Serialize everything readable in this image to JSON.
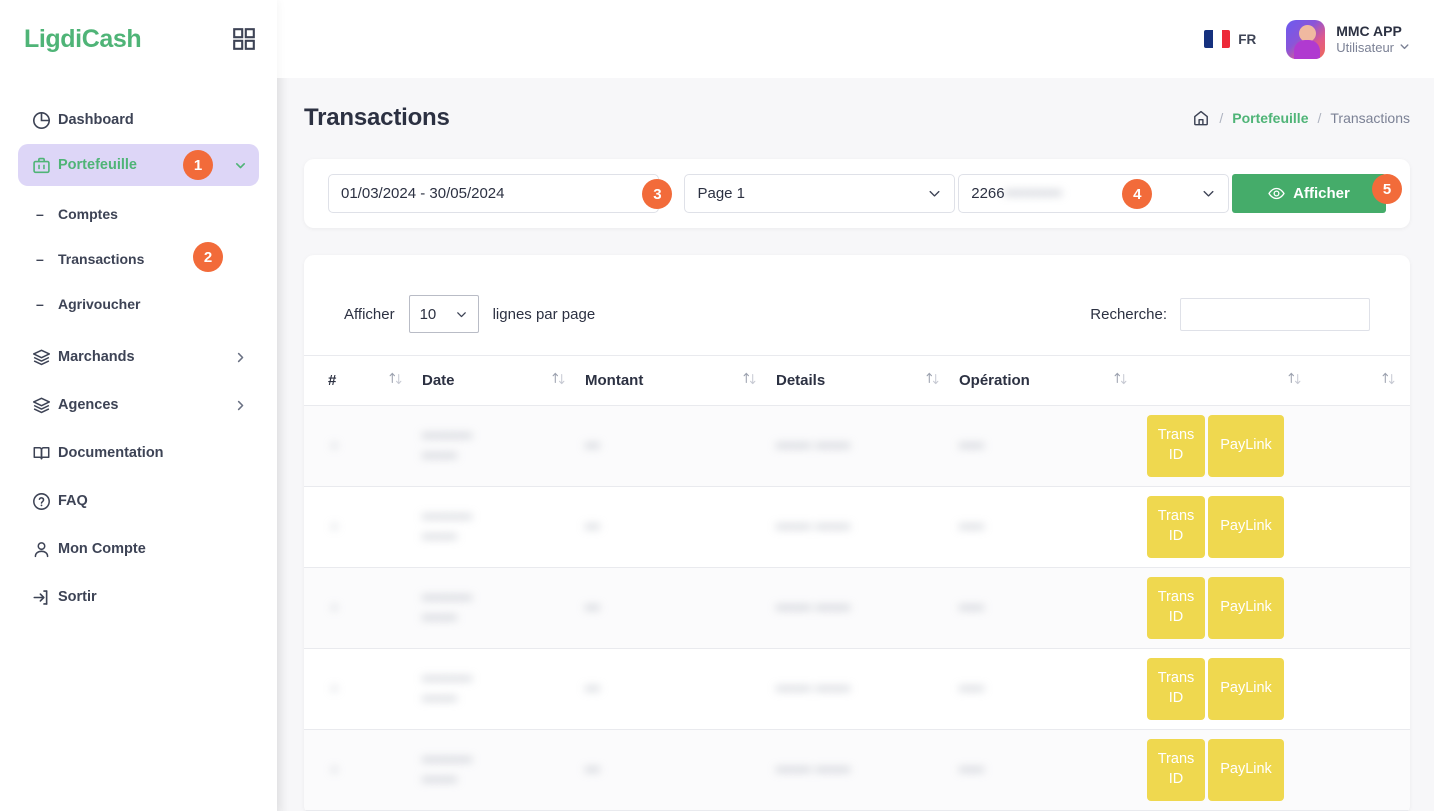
{
  "brand": {
    "name": "LigdiCash",
    "grid_icon": "grid-icon"
  },
  "header": {
    "language": {
      "code": "FR",
      "flag": "french-flag-icon"
    },
    "user": {
      "name": "MMC APP",
      "role": "Utilisateur",
      "avatar": "user-avatar"
    }
  },
  "sidebar": {
    "items": [
      {
        "label": "Dashboard",
        "icon": "pie-chart-icon"
      },
      {
        "label": "Portefeuille",
        "icon": "briefcase-icon",
        "active": true,
        "badge": "1",
        "chevron": "chevron-down-icon"
      },
      {
        "label": "Comptes",
        "icon": "dash-icon",
        "sub": true
      },
      {
        "label": "Transactions",
        "icon": "dash-icon",
        "sub": true,
        "badge": "2"
      },
      {
        "label": "Agrivoucher",
        "icon": "dash-icon",
        "sub": true
      },
      {
        "label": "Marchands",
        "icon": "layers-icon",
        "chevron": "chevron-right-icon"
      },
      {
        "label": "Agences",
        "icon": "layers-icon",
        "chevron": "chevron-right-icon"
      },
      {
        "label": "Documentation",
        "icon": "book-icon"
      },
      {
        "label": "FAQ",
        "icon": "question-circle-icon"
      },
      {
        "label": "Mon Compte",
        "icon": "user-icon"
      },
      {
        "label": "Sortir",
        "icon": "logout-icon"
      }
    ]
  },
  "page": {
    "title": "Transactions",
    "breadcrumb": {
      "home_icon": "home-icon",
      "sep": "/",
      "link": "Portefeuille",
      "current": "Transactions"
    }
  },
  "filters": {
    "date_range": "01/03/2024 - 30/05/2024",
    "date_badge": "3",
    "page_select": "Page 1",
    "account_select": "2266",
    "account_select_masked": "••••••••••",
    "account_badge": "4",
    "submit_label": "Afficher",
    "submit_icon": "eye-icon",
    "submit_badge": "5"
  },
  "table": {
    "length_prefix": "Afficher",
    "length_value": "10",
    "length_suffix": "lignes par page",
    "search_label": "Recherche:",
    "search_value": "",
    "search_placeholder": "",
    "columns": [
      {
        "label": "#",
        "sort": "sort-icon"
      },
      {
        "label": "Date",
        "sort": "sort-icon"
      },
      {
        "label": "Montant",
        "sort": "sort-icon"
      },
      {
        "label": "Details",
        "sort": "sort-icon"
      },
      {
        "label": "Opération",
        "sort": "sort-icon"
      },
      {
        "label": "",
        "sort": "sort-icon"
      },
      {
        "label": "",
        "sort": "sort-icon"
      }
    ],
    "action_labels": {
      "trans_id": "Trans ID",
      "trans_id_l1": "Trans",
      "trans_id_l2": "ID",
      "paylink": "PayLink"
    },
    "rows": [
      {
        "num": "•",
        "date": "••••••••••\n•••••••",
        "montant": "•••",
        "details": "••••••• •••••••",
        "operation": "•••••"
      },
      {
        "num": "•",
        "date": "••••••••••\n•••••••",
        "montant": "•••",
        "details": "••••••• •••••••",
        "operation": "•••••"
      },
      {
        "num": "•",
        "date": "••••••••••\n•••••••",
        "montant": "•••",
        "details": "••••••• •••••••",
        "operation": "•••••"
      },
      {
        "num": "•",
        "date": "••••••••••\n•••••••",
        "montant": "•••",
        "details": "••••••• •••••••",
        "operation": "•••••"
      },
      {
        "num": "•",
        "date": "••••••••••\n•••••••",
        "montant": "•••",
        "details": "••••••• •••••••",
        "operation": "•••••"
      }
    ]
  },
  "colors": {
    "brand_green": "#4fb477",
    "accent_green": "#45ac6a",
    "badge_orange": "#f26b3a",
    "active_lilac": "#ddd6f7",
    "action_yellow": "#efd84f",
    "text_dark": "#2c3142",
    "page_bg": "#f7f7f9"
  }
}
